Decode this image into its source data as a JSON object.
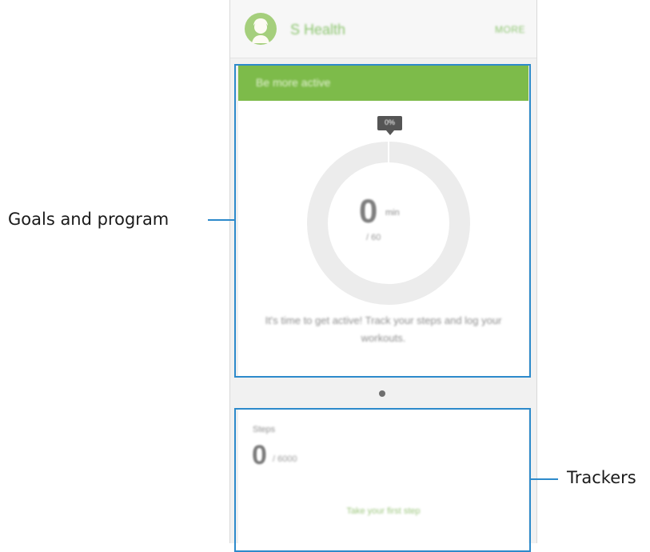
{
  "app": {
    "title": "S Health",
    "more_label": "MORE"
  },
  "goal_card": {
    "header": "Be more active",
    "percent_badge": "0%",
    "progress_fraction": 0,
    "active_value": "0",
    "active_unit": "min",
    "target_text": "/ 60",
    "message": "It's time to get active! Track your steps and log your workouts."
  },
  "tracker_card": {
    "label": "Steps",
    "value": "0",
    "unit": "/ 6000",
    "cta": "Take your first step"
  },
  "pager": {
    "pages": 1,
    "current": 1
  },
  "callouts": {
    "goals": "Goals and program",
    "trackers": "Trackers"
  },
  "colors": {
    "accent_green": "#7dbb4a",
    "title_green": "#8cc56f",
    "highlight_blue": "#2d8acb",
    "ring_track": "#ececec"
  }
}
